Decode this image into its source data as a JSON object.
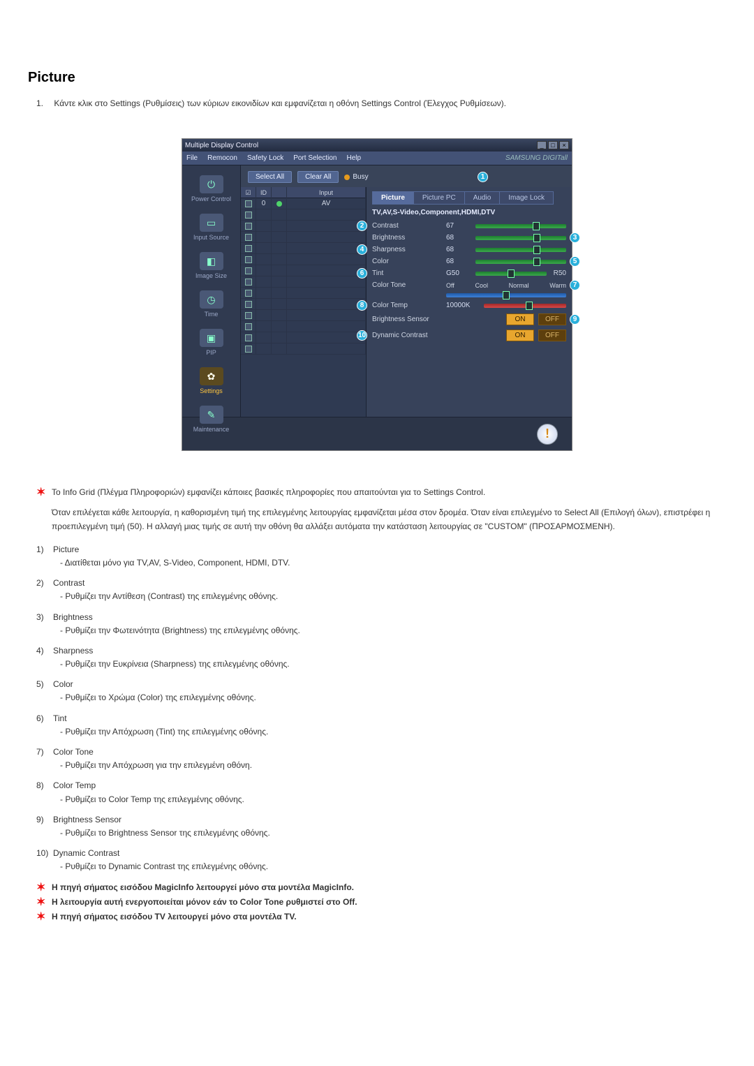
{
  "heading": "Picture",
  "intro_number": "1.",
  "intro_text": "Κάντε κλικ στο Settings (Ρυθμίσεις) των κύριων εικονιδίων και εμφανίζεται η οθόνη Settings Control (Έλεγχος Ρυθμίσεων).",
  "app": {
    "title": "Multiple Display Control",
    "menu": [
      "File",
      "Remocon",
      "Safety Lock",
      "Port Selection",
      "Help"
    ],
    "brand": "SAMSUNG DIGITall",
    "toolbar": {
      "select_all": "Select All",
      "clear_all": "Clear All",
      "busy": "Busy"
    },
    "sidebar": [
      {
        "label": "Power Control",
        "glyph": "⏻"
      },
      {
        "label": "Input Source",
        "glyph": "▭"
      },
      {
        "label": "Image Size",
        "glyph": "◧"
      },
      {
        "label": "Time",
        "glyph": "◷"
      },
      {
        "label": "PIP",
        "glyph": "▣"
      },
      {
        "label": "Settings",
        "glyph": "✿",
        "active": true
      },
      {
        "label": "Maintenance",
        "glyph": "✎"
      }
    ],
    "grid": {
      "headers": [
        "☑",
        "ID",
        "",
        "Input"
      ],
      "first_row": [
        "☑",
        "0",
        "●",
        "AV"
      ]
    },
    "tabs": [
      "Picture",
      "Picture PC",
      "Audio",
      "Image Lock"
    ],
    "panel_header": "TV,AV,S-Video,Component,HDMI,DTV",
    "controls": {
      "contrast": {
        "label": "Contrast",
        "value": "67"
      },
      "brightness": {
        "label": "Brightness",
        "value": "68"
      },
      "sharpness": {
        "label": "Sharpness",
        "value": "68"
      },
      "color": {
        "label": "Color",
        "value": "68"
      },
      "tint": {
        "label": "Tint",
        "value": "G50",
        "value_r": "R50"
      },
      "colortone": {
        "label": "Color Tone",
        "opts": [
          "Off",
          "Cool",
          "Normal",
          "Warm"
        ]
      },
      "colortemp": {
        "label": "Color Temp",
        "value": "10000K"
      },
      "brsensor": {
        "label": "Brightness Sensor",
        "on": "ON",
        "off": "OFF"
      },
      "dyncontrast": {
        "label": "Dynamic Contrast",
        "on": "ON",
        "off": "OFF"
      }
    },
    "callouts": {
      "c1": "1",
      "c2": "2",
      "c3": "3",
      "c4": "4",
      "c5": "5",
      "c6": "6",
      "c7": "7",
      "c8": "8",
      "c9": "9",
      "c10": "10"
    }
  },
  "notes": {
    "star_main": "Το Info Grid (Πλέγμα Πληροφοριών) εμφανίζει κάποιες βασικές πληροφορίες που απαιτούνται για το Settings Control.",
    "para1": "Όταν επιλέγεται κάθε λειτουργία, η καθορισμένη τιμή της επιλεγμένης λειτουργίας εμφανίζεται μέσα στον δρομέα. Όταν είναι επιλεγμένο το Select All (Επιλογή όλων), επιστρέφει η προεπιλεγμένη τιμή (50). Η αλλαγή μιας τιμής σε αυτή την οθόνη θα αλλάξει αυτόματα την κατάσταση λειτουργίας σε \"CUSTOM\" (ΠΡΟΣΑΡΜΟΣΜΕΝΗ).",
    "items": [
      {
        "n": "1)",
        "title": "Picture",
        "sub": "- Διατίθεται μόνο για TV,AV, S-Video, Component, HDMI, DTV."
      },
      {
        "n": "2)",
        "title": "Contrast",
        "sub": "- Ρυθμίζει την Αντίθεση (Contrast) της επιλεγμένης οθόνης."
      },
      {
        "n": "3)",
        "title": "Brightness",
        "sub": "- Ρυθμίζει την Φωτεινότητα (Brightness) της επιλεγμένης οθόνης."
      },
      {
        "n": "4)",
        "title": "Sharpness",
        "sub": "- Ρυθμίζει την Ευκρίνεια (Sharpness) της επιλεγμένης οθόνης."
      },
      {
        "n": "5)",
        "title": "Color",
        "sub": "- Ρυθμίζει το Χρώμα (Color) της επιλεγμένης οθόνης."
      },
      {
        "n": "6)",
        "title": "Tint",
        "sub": "- Ρυθμίζει την Απόχρωση (Tint) της επιλεγμένης οθόνης."
      },
      {
        "n": "7)",
        "title": "Color Tone",
        "sub": "- Ρυθμίζει την Απόχρωση για την επιλεγμένη οθόνη."
      },
      {
        "n": "8)",
        "title": "Color Temp",
        "sub": "- Ρυθμίζει το Color Temp της επιλεγμένης οθόνης."
      },
      {
        "n": "9)",
        "title": "Brightness Sensor",
        "sub": "- Ρυθμίζει το Brightness Sensor της επιλεγμένης οθόνης."
      },
      {
        "n": "10)",
        "title": "Dynamic Contrast",
        "sub": "- Ρυθμίζει το Dynamic Contrast της επιλεγμένης οθόνης."
      }
    ],
    "star_b1": "Η πηγή σήματος εισόδου MagicInfo λειτουργεί μόνο στα μοντέλα MagicInfo.",
    "star_b2": "Η λειτουργία αυτή ενεργοποιείται μόνον εάν το Color Tone ρυθμιστεί στο Off.",
    "star_b3": "Η πηγή σήματος εισόδου TV λειτουργεί μόνο στα μοντέλα TV."
  }
}
